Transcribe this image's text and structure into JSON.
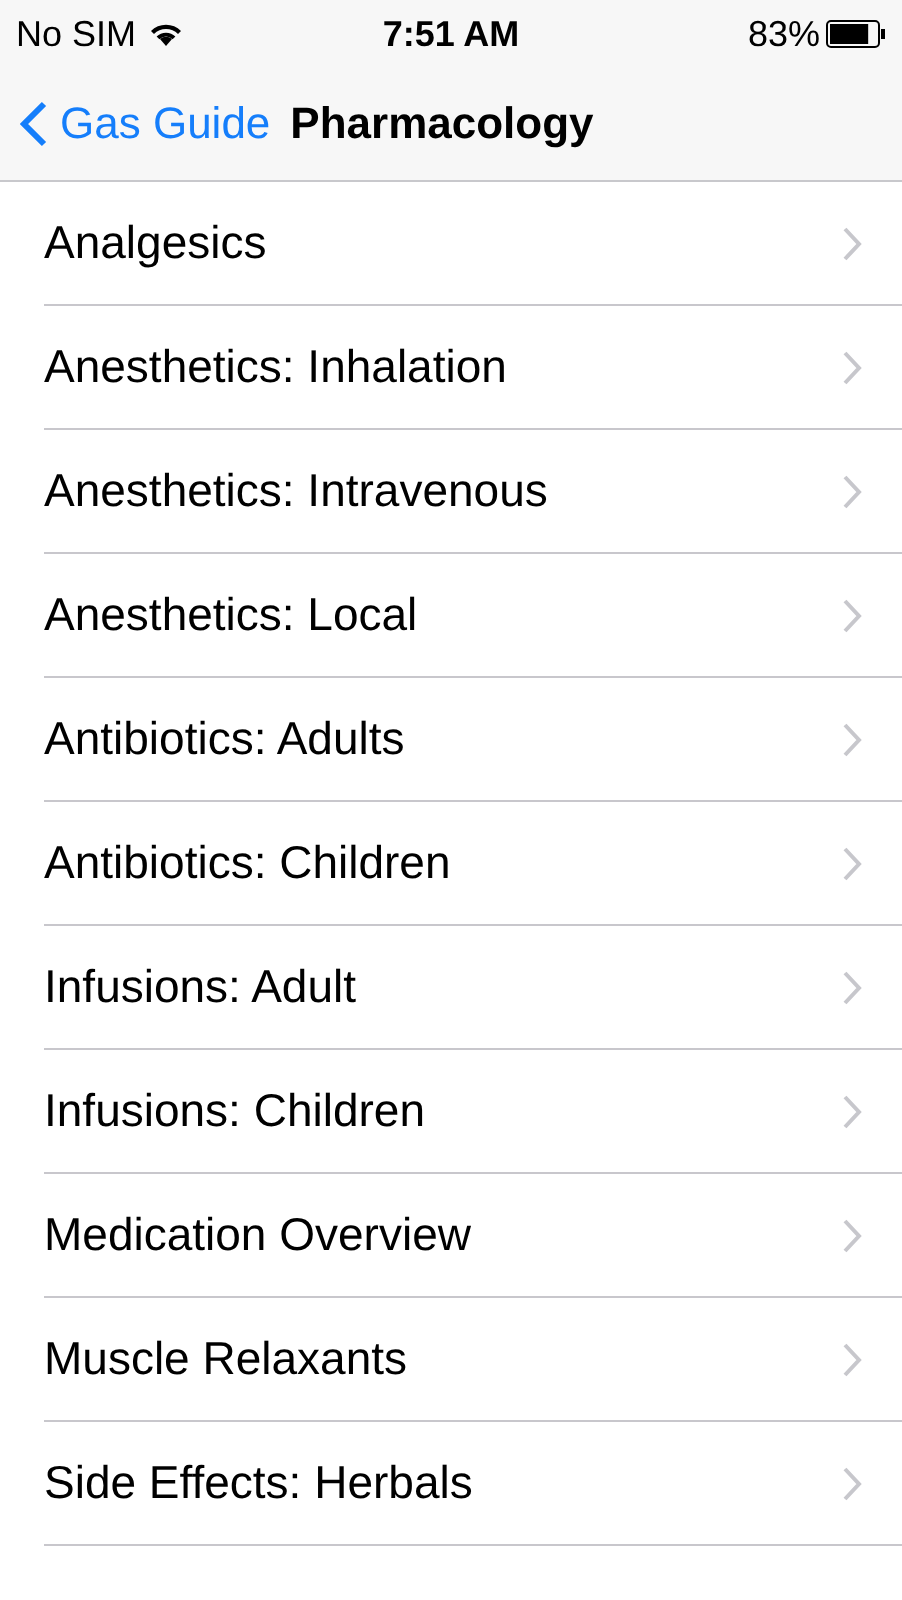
{
  "status_bar": {
    "carrier": "No SIM",
    "time": "7:51 AM",
    "battery": "83%"
  },
  "nav_bar": {
    "back": "Gas Guide",
    "title": "Pharmacology"
  },
  "items": [
    {
      "label": "Analgesics"
    },
    {
      "label": "Anesthetics: Inhalation"
    },
    {
      "label": "Anesthetics: Intravenous"
    },
    {
      "label": "Anesthetics: Local"
    },
    {
      "label": "Antibiotics: Adults"
    },
    {
      "label": "Antibiotics: Children"
    },
    {
      "label": "Infusions: Adult"
    },
    {
      "label": "Infusions: Children"
    },
    {
      "label": "Medication Overview"
    },
    {
      "label": "Muscle Relaxants"
    },
    {
      "label": "Side Effects: Herbals"
    }
  ]
}
